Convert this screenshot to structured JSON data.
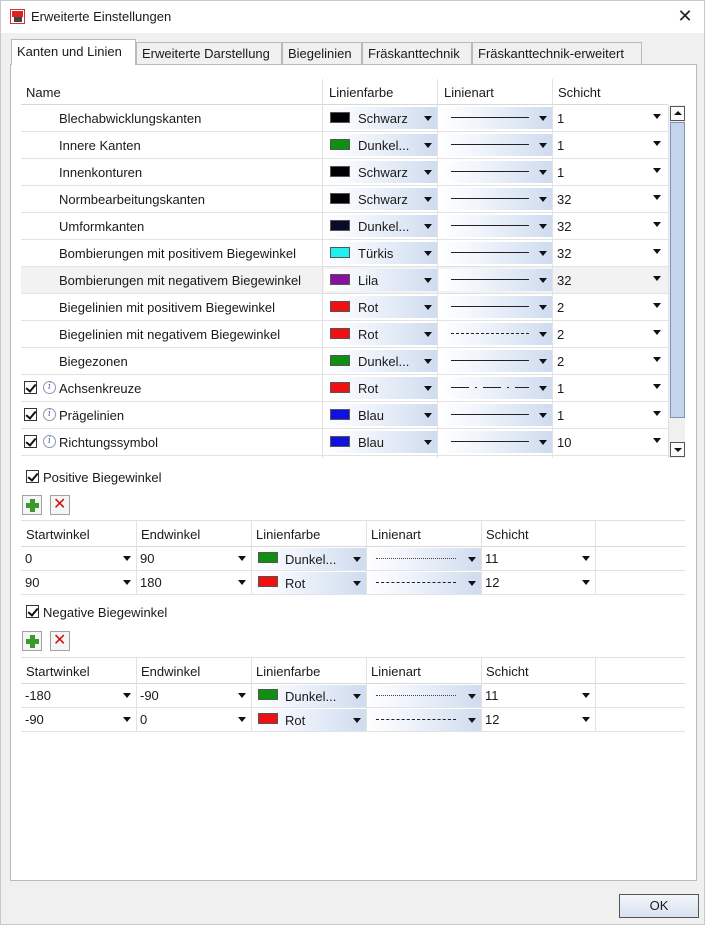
{
  "window": {
    "title": "Erweiterte Einstellungen"
  },
  "tabs": [
    {
      "label": "Kanten und Linien"
    },
    {
      "label": "Erweiterte Darstellung"
    },
    {
      "label": "Biegelinien"
    },
    {
      "label": "Fräskanttechnik"
    },
    {
      "label": "Fräskanttechnik-erweitert"
    }
  ],
  "grid": {
    "headers": {
      "name": "Name",
      "color": "Linienfarbe",
      "linetype": "Linienart",
      "layer": "Schicht"
    },
    "rows": [
      {
        "name": "Blechabwicklungskanten",
        "color_name": "Schwarz",
        "color": "#000000",
        "linetype": "solid",
        "layer": "1"
      },
      {
        "name": "Innere Kanten",
        "color_name": "Dunkel...",
        "color": "#109010",
        "linetype": "solid",
        "layer": "1"
      },
      {
        "name": "Innenkonturen",
        "color_name": "Schwarz",
        "color": "#000000",
        "linetype": "solid",
        "layer": "1"
      },
      {
        "name": "Normbearbeitungskanten",
        "color_name": "Schwarz",
        "color": "#000000",
        "linetype": "solid",
        "layer": "32"
      },
      {
        "name": "Umformkanten",
        "color_name": "Dunkel...",
        "color": "#0a0a2a",
        "linetype": "solid",
        "layer": "32"
      },
      {
        "name": "Bombierungen mit positivem Biegewinkel",
        "color_name": "Türkis",
        "color": "#20f0f0",
        "linetype": "solid",
        "layer": "32"
      },
      {
        "name": "Bombierungen mit negativem Biegewinkel",
        "color_name": "Lila",
        "color": "#8a10a0",
        "linetype": "solid",
        "layer": "32"
      },
      {
        "name": "Biegelinien mit positivem Biegewinkel",
        "color_name": "Rot",
        "color": "#f01010",
        "linetype": "solid",
        "layer": "2"
      },
      {
        "name": "Biegelinien mit negativem Biegewinkel",
        "color_name": "Rot",
        "color": "#f01010",
        "linetype": "dashed",
        "layer": "2"
      },
      {
        "name": "Biegezonen",
        "color_name": "Dunkel...",
        "color": "#109010",
        "linetype": "solid",
        "layer": "2"
      },
      {
        "name": "Achsenkreuze",
        "color_name": "Rot",
        "color": "#f01010",
        "linetype": "dashdot",
        "layer": "1"
      },
      {
        "name": "Prägelinien",
        "color_name": "Blau",
        "color": "#1010e0",
        "linetype": "solid",
        "layer": "1"
      },
      {
        "name": "Richtungssymbol",
        "color_name": "Blau",
        "color": "#1010e0",
        "linetype": "solid",
        "layer": "10"
      }
    ]
  },
  "positive": {
    "label": "Positive Biegewinkel",
    "headers": {
      "start": "Startwinkel",
      "end": "Endwinkel",
      "color": "Linienfarbe",
      "linetype": "Linienart",
      "layer": "Schicht"
    },
    "rows": [
      {
        "start": "0",
        "end": "90",
        "color_name": "Dunkel...",
        "color": "#109010",
        "linetype": "dotted",
        "layer": "11"
      },
      {
        "start": "90",
        "end": "180",
        "color_name": "Rot",
        "color": "#f01010",
        "linetype": "dashed",
        "layer": "12"
      }
    ]
  },
  "negative": {
    "label": "Negative Biegewinkel",
    "headers": {
      "start": "Startwinkel",
      "end": "Endwinkel",
      "color": "Linienfarbe",
      "linetype": "Linienart",
      "layer": "Schicht"
    },
    "rows": [
      {
        "start": "-180",
        "end": "-90",
        "color_name": "Dunkel...",
        "color": "#109010",
        "linetype": "dotted",
        "layer": "11"
      },
      {
        "start": "-90",
        "end": "0",
        "color_name": "Rot",
        "color": "#f01010",
        "linetype": "dashed",
        "layer": "12"
      }
    ]
  },
  "ok_label": "OK"
}
